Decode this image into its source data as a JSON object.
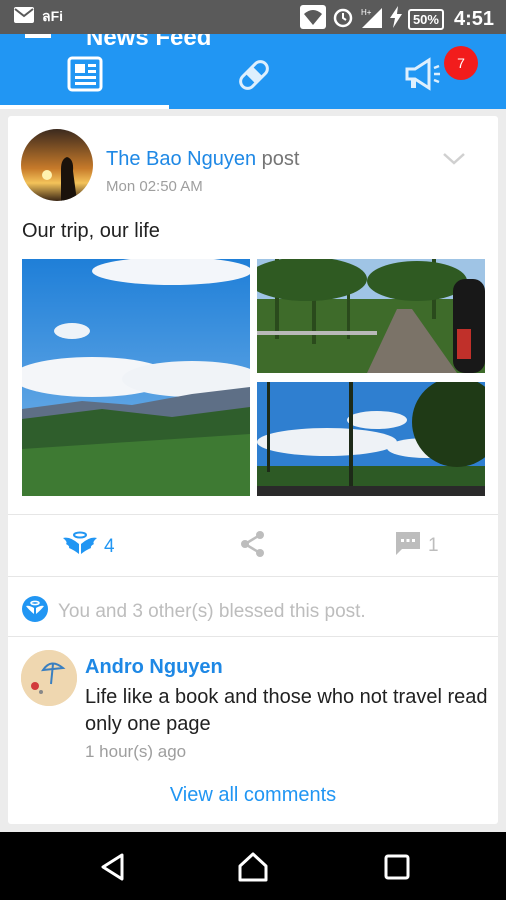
{
  "status_bar": {
    "carrier": "ลFi",
    "battery": "50%",
    "time": "4:51",
    "icons": [
      "mail-icon",
      "wifi-icon",
      "alarm-icon",
      "signal-icon",
      "charging-icon"
    ]
  },
  "app_bar": {
    "title": "News Feed",
    "tabs": [
      {
        "icon": "newspaper-icon"
      },
      {
        "icon": "bandage-icon"
      },
      {
        "icon": "megaphone-icon",
        "badge": "7"
      }
    ],
    "colors": {
      "primary": "#2196f3",
      "badge": "#f21c1c"
    }
  },
  "post": {
    "author": "The Bao Nguyen",
    "action": "post",
    "time": "Mon 02:50 AM",
    "text": "Our trip, our life",
    "photos": [
      "photo-sky-mountains",
      "photo-pine-road",
      "photo-pine-sky"
    ],
    "actions": {
      "bless_count": "4",
      "comment_count": "1",
      "icons": [
        "angel-wings-icon",
        "share-icon",
        "comment-icon"
      ]
    },
    "blessed_text": "You and 3 other(s) blessed this post."
  },
  "comment": {
    "author": "Andro Nguyen",
    "text": "Life like a book and those who not travel read only one page",
    "time": "1 hour(s) ago"
  },
  "view_all": "View all comments",
  "nav": [
    "back-icon",
    "home-icon",
    "recents-icon"
  ]
}
